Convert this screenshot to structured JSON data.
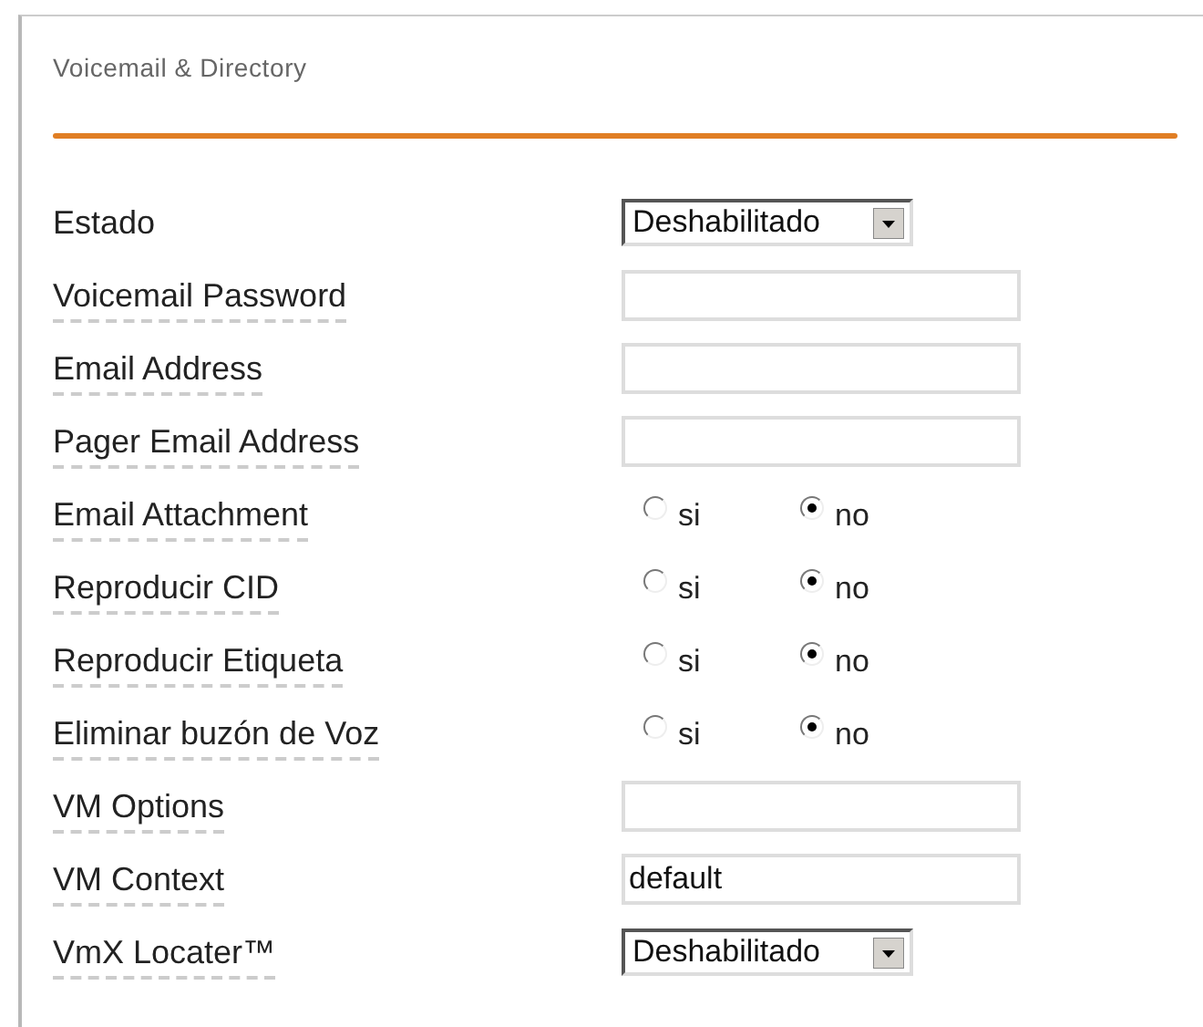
{
  "panel": {
    "title": "Voicemail & Directory"
  },
  "fields": [
    {
      "kind": "select",
      "label": "Estado",
      "has_help": false,
      "value": "Deshabilitado"
    },
    {
      "kind": "text",
      "label": "Voicemail Password",
      "has_help": true
    },
    {
      "kind": "text",
      "label": "Email Address",
      "has_help": true
    },
    {
      "kind": "text",
      "label": "Pager Email Address",
      "has_help": true
    },
    {
      "kind": "radio",
      "label": "Email Attachment",
      "has_help": true,
      "options": [
        {
          "label": "si",
          "selected": false
        },
        {
          "label": "no",
          "selected": true
        }
      ]
    },
    {
      "kind": "radio",
      "label": "Reproducir CID",
      "has_help": true,
      "options": [
        {
          "label": "si",
          "selected": false
        },
        {
          "label": "no",
          "selected": true
        }
      ]
    },
    {
      "kind": "radio",
      "label": "Reproducir Etiqueta",
      "has_help": true,
      "options": [
        {
          "label": "si",
          "selected": false
        },
        {
          "label": "no",
          "selected": true
        }
      ]
    },
    {
      "kind": "radio",
      "label": "Eliminar buzón de Voz",
      "has_help": true,
      "options": [
        {
          "label": "si",
          "selected": false
        },
        {
          "label": "no",
          "selected": true
        }
      ]
    },
    {
      "kind": "text",
      "label": "VM Options",
      "has_help": true
    },
    {
      "kind": "text",
      "label": "VM Context",
      "has_help": true,
      "value": "default"
    },
    {
      "kind": "select",
      "label": "VmX Locater™",
      "has_help": true,
      "value": "Deshabilitado"
    }
  ]
}
